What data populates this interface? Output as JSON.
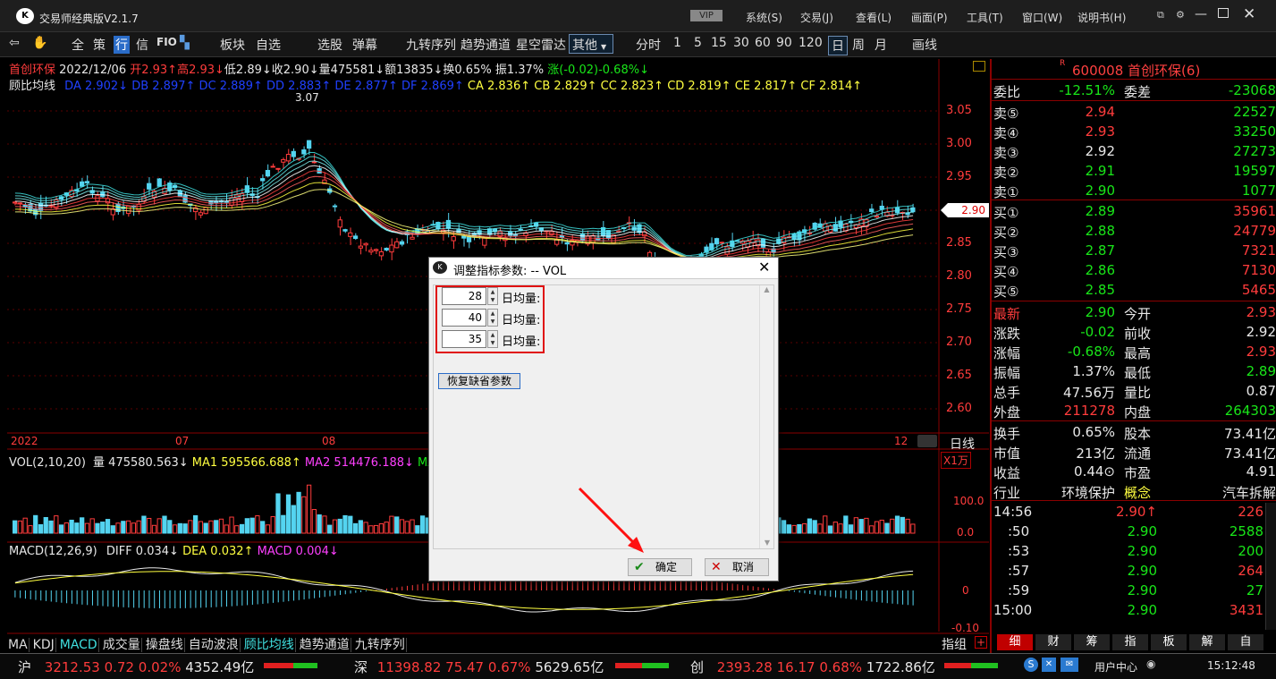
{
  "app": {
    "title": "交易师经典版V2.1.7",
    "vip": "VIP",
    "menus": [
      "系统(S)",
      "交易(J)",
      "查看(L)",
      "画面(P)",
      "工具(T)",
      "窗口(W)",
      "说明书(H)"
    ]
  },
  "toolbar": {
    "items": [
      "全",
      "策",
      "行",
      "信",
      "FIO",
      "板块",
      "自选",
      "选股",
      "弹幕",
      "九转序列",
      "趋势通道",
      "星空雷达"
    ],
    "select": "其他",
    "periods": [
      "分时",
      "1",
      "5",
      "15",
      "30",
      "60",
      "90",
      "120",
      "日",
      "周",
      "月"
    ],
    "draw": "画线"
  },
  "quote": {
    "name": "首创环保",
    "date": "2022/12/06",
    "open": "开2.93↑",
    "high": "高2.93↓",
    "low": "低2.89↓",
    "close": "收2.90↓",
    "vol": "量475581↓",
    "amount": "额13835↓",
    "turnover": "换0.65%",
    "amp": "振1.37%",
    "chg": "涨(-0.02)-0.68%↓"
  },
  "gubi": {
    "label": "顾比均线",
    "da": "DA 2.902↓",
    "db": "DB 2.897↑",
    "dc": "DC 2.889↑",
    "dd": "DD 2.883↑",
    "de": "DE 2.877↑",
    "df": "DF 2.869↑",
    "ca": "CA 2.836↑",
    "cb": "CB 2.829↑",
    "cc": "CC 2.823↑",
    "cd": "CD 2.819↑",
    "ce": "CE 2.817↑",
    "cf": "CF 2.814↑"
  },
  "price_axis": [
    "3.05",
    "3.00",
    "2.95",
    "2.90",
    "2.85",
    "2.80",
    "2.75",
    "2.70",
    "2.65",
    "2.60"
  ],
  "high_mark": "3.07",
  "current_price": "2.90",
  "time_axis": [
    "2022",
    "07",
    "08",
    "12"
  ],
  "period_label": "日线",
  "vol": {
    "label": "VOL(2,10,20)",
    "amount": "量 475580.563↓",
    "ma1": "MA1 595566.688↑",
    "ma2": "MA2 514476.188↓",
    "ma3": "MA",
    "unit": "X1万",
    "axis": [
      "100.0",
      "0.0"
    ]
  },
  "macd": {
    "label": "MACD(12,26,9)",
    "diff": "DIFF 0.034↓",
    "dea": "DEA 0.032↑",
    "macd": "MACD 0.004↓",
    "axis": [
      "0",
      "-0.10"
    ]
  },
  "indicator_tabs": [
    "MA",
    "KDJ",
    "MACD",
    "成交量",
    "操盘线",
    "自动波浪",
    "顾比均线",
    "趋势通道",
    "九转序列"
  ],
  "right": {
    "code": "600008",
    "name": "首创环保(6)",
    "weibi": {
      "l1": "委比",
      "v1": "-12.51%",
      "l2": "委差",
      "v2": "-23068"
    },
    "sells": [
      {
        "l": "卖⑤",
        "p": "2.94",
        "v": "22527",
        "c": "red"
      },
      {
        "l": "卖④",
        "p": "2.93",
        "v": "33250",
        "c": "red"
      },
      {
        "l": "卖③",
        "p": "2.92",
        "v": "27273",
        "c": "wht"
      },
      {
        "l": "卖②",
        "p": "2.91",
        "v": "19597",
        "c": "grn"
      },
      {
        "l": "卖①",
        "p": "2.90",
        "v": "1077",
        "c": "grn"
      }
    ],
    "buys": [
      {
        "l": "买①",
        "p": "2.89",
        "v": "35961",
        "c": "grn"
      },
      {
        "l": "买②",
        "p": "2.88",
        "v": "24779",
        "c": "grn"
      },
      {
        "l": "买③",
        "p": "2.87",
        "v": "7321",
        "c": "grn"
      },
      {
        "l": "买④",
        "p": "2.86",
        "v": "7130",
        "c": "grn"
      },
      {
        "l": "买⑤",
        "p": "2.85",
        "v": "5465",
        "c": "grn"
      }
    ],
    "stats": [
      {
        "a": "最新",
        "av": "2.90",
        "ac": "grn",
        "b": "今开",
        "bv": "2.93",
        "bc": "red"
      },
      {
        "a": "涨跌",
        "av": "-0.02",
        "ac": "grn",
        "b": "前收",
        "bv": "2.92",
        "bc": "wht"
      },
      {
        "a": "涨幅",
        "av": "-0.68%",
        "ac": "grn",
        "b": "最高",
        "bv": "2.93",
        "bc": "red"
      },
      {
        "a": "振幅",
        "av": "1.37%",
        "ac": "wht",
        "b": "最低",
        "bv": "2.89",
        "bc": "grn"
      },
      {
        "a": "总手",
        "av": "47.56万",
        "ac": "wht",
        "b": "量比",
        "bv": "0.87",
        "bc": "wht"
      },
      {
        "a": "外盘",
        "av": "211278",
        "ac": "red",
        "b": "内盘",
        "bv": "264303",
        "bc": "grn"
      }
    ],
    "stats2": [
      {
        "a": "换手",
        "av": "0.65%",
        "b": "股本",
        "bv": "73.41亿"
      },
      {
        "a": "市值",
        "av": "213亿",
        "b": "流通",
        "bv": "73.41亿"
      },
      {
        "a": "收益",
        "av": "0.44⊙",
        "b": "市盈",
        "bv": "4.91"
      },
      {
        "a": "行业",
        "av": "环境保护",
        "b": "概念",
        "bv": "汽车拆解"
      }
    ],
    "ticks": [
      {
        "t": "14:56",
        "p": "2.90↑",
        "v": "226",
        "pc": "red"
      },
      {
        "t": ":50",
        "p": "2.90",
        "v": "2588",
        "pc": "grn"
      },
      {
        "t": ":53",
        "p": "2.90",
        "v": "200",
        "pc": "grn"
      },
      {
        "t": ":57",
        "p": "2.90",
        "v": "264",
        "pc": "grn"
      },
      {
        "t": ":59",
        "p": "2.90",
        "v": "27",
        "pc": "grn"
      },
      {
        "t": "15:00",
        "p": "2.90",
        "v": "3431",
        "pc": "grn"
      }
    ],
    "tabs": [
      "细",
      "财",
      "筹",
      "指",
      "板",
      "解",
      "自"
    ],
    "zhizu": "指组"
  },
  "status": {
    "sh_l": "沪",
    "sh_v": "3212.53",
    "sh_c": "0.72",
    "sh_p": "0.02%",
    "sh_a": "4352.49亿",
    "sz_l": "深",
    "sz_v": "11398.82",
    "sz_c": "75.47",
    "sz_p": "0.67%",
    "sz_a": "5629.65亿",
    "cy_l": "创",
    "cy_v": "2393.28",
    "cy_c": "16.17",
    "cy_p": "0.68%",
    "cy_a": "1722.86亿",
    "user": "用户中心",
    "clock": "15:12:48"
  },
  "dialog": {
    "title": "调整指标参数: -- VOL",
    "params": [
      {
        "value": "28",
        "label": "日均量:"
      },
      {
        "value": "40",
        "label": "日均量:"
      },
      {
        "value": "35",
        "label": "日均量:"
      }
    ],
    "restore": "恢复缺省参数",
    "ok": "确定",
    "cancel": "取消"
  }
}
